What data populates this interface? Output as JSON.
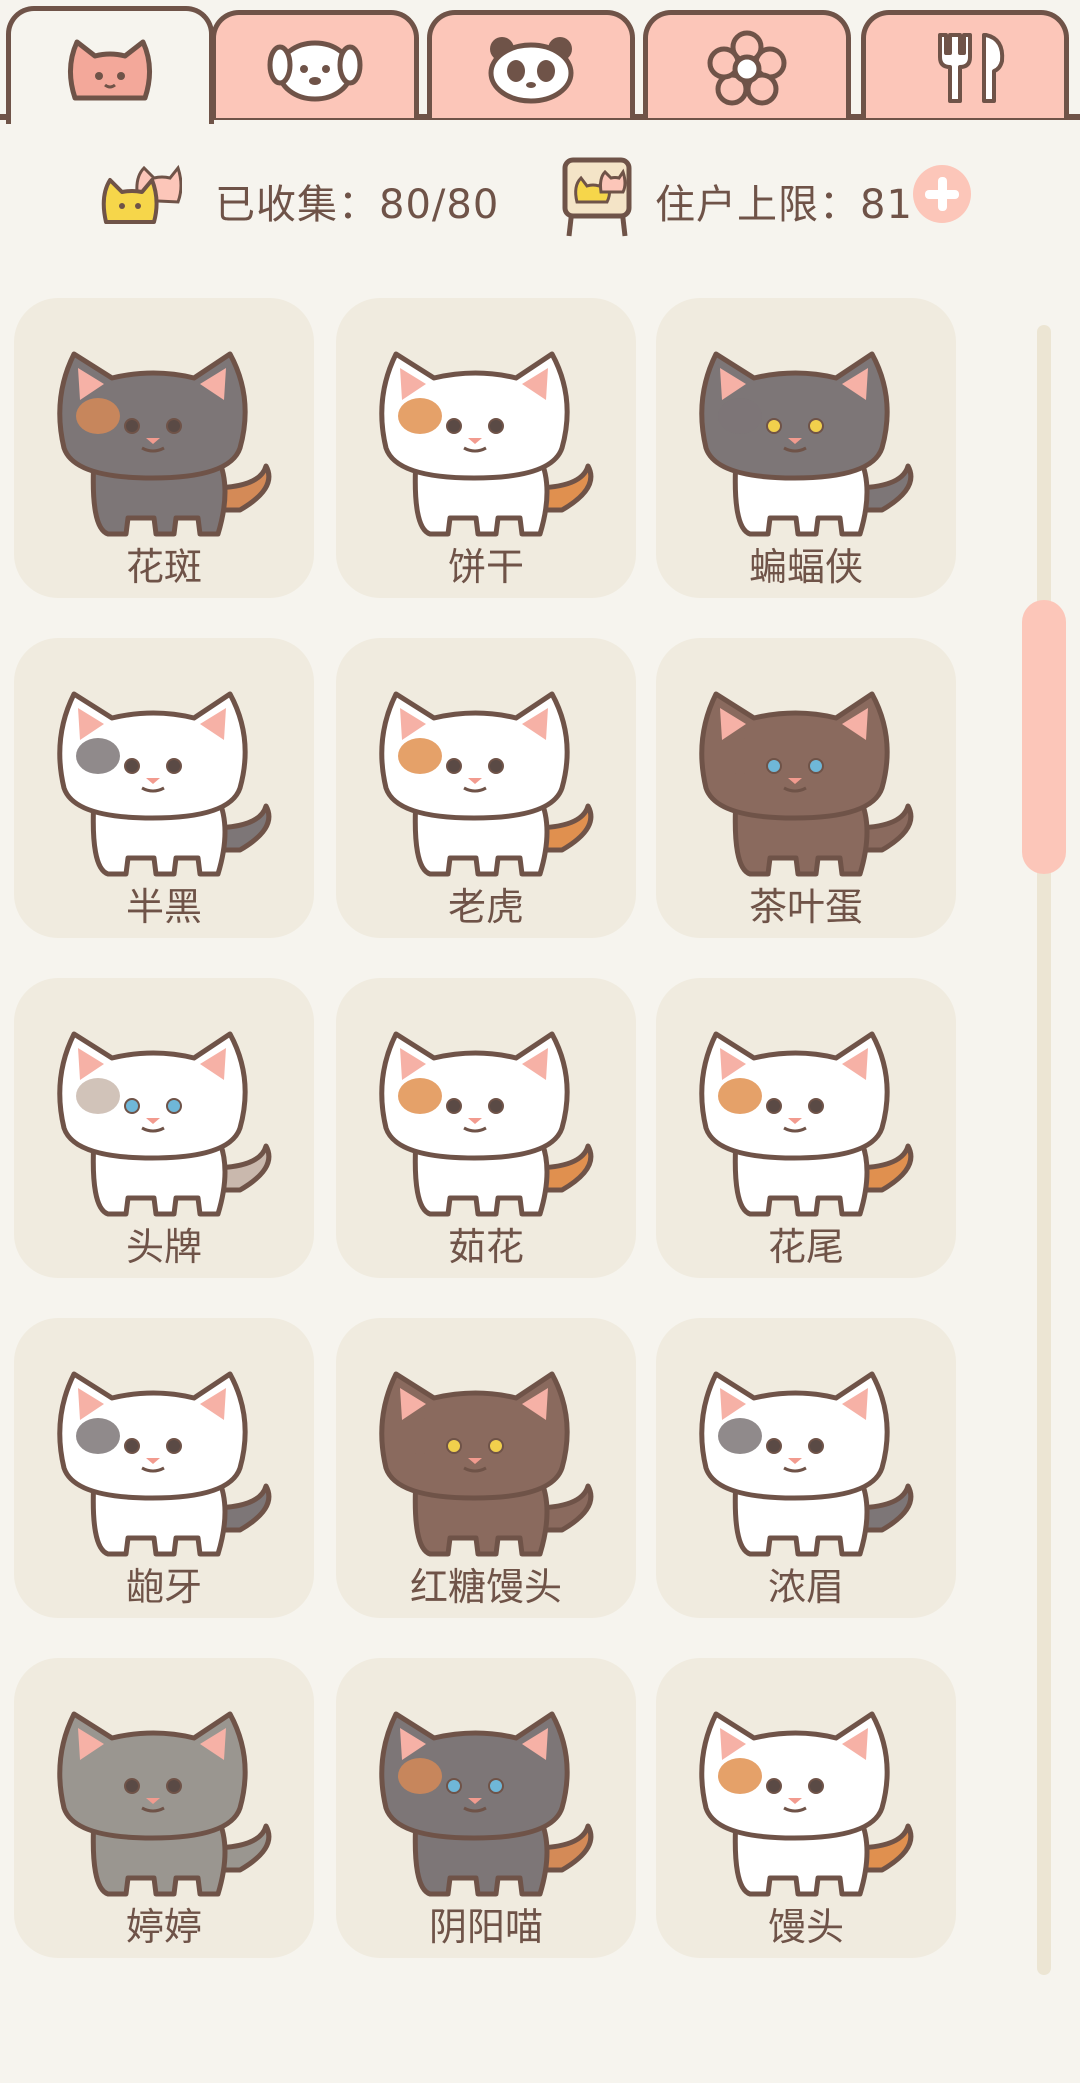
{
  "tabs": [
    {
      "id": "cats",
      "icon": "cat-face-icon",
      "active": true
    },
    {
      "id": "dogs",
      "icon": "dog-face-icon",
      "active": false
    },
    {
      "id": "pandas",
      "icon": "panda-face-icon",
      "active": false
    },
    {
      "id": "flowers",
      "icon": "flower-icon",
      "active": false
    },
    {
      "id": "food",
      "icon": "fork-spoon-icon",
      "active": false
    }
  ],
  "stats": {
    "collected_label": "已收集：80/80",
    "residents_label": "住户上限：81"
  },
  "colors": {
    "tab_bg": "#fcc6b9",
    "outline": "#6f5348",
    "page_bg": "#f6f4ee",
    "card_bg": "#f0ebdf",
    "scroll_thumb": "#fcc6b9"
  },
  "cats": [
    {
      "name": "花斑",
      "body": "#7d7677",
      "patch": "#d48a57",
      "head": "#7d7677",
      "eye": "#5a4a45"
    },
    {
      "name": "饼干",
      "body": "#ffffff",
      "patch": "#e0904f",
      "head": "#ffffff",
      "eye": "#5a4a45"
    },
    {
      "name": "蝙蝠侠",
      "body": "#ffffff",
      "patch": "#7d7677",
      "head": "#7d7677",
      "eye": "#f1d04c"
    },
    {
      "name": "半黑",
      "body": "#ffffff",
      "patch": "#7d7677",
      "head": "#ffffff",
      "eye": "#5a4a45"
    },
    {
      "name": "老虎",
      "body": "#ffffff",
      "patch": "#e0904f",
      "head": "#ffffff",
      "eye": "#5a4a45"
    },
    {
      "name": "茶叶蛋",
      "body": "#8a6a5e",
      "patch": "#8a6a5e",
      "head": "#8a6a5e",
      "eye": "#6fb7d8"
    },
    {
      "name": "头牌",
      "body": "#ffffff",
      "patch": "#c9b8ad",
      "head": "#ffffff",
      "eye": "#6fb7d8"
    },
    {
      "name": "茹花",
      "body": "#ffffff",
      "patch": "#e0904f",
      "head": "#ffffff",
      "eye": "#5a4a45"
    },
    {
      "name": "花尾",
      "body": "#ffffff",
      "patch": "#e0904f",
      "head": "#ffffff",
      "eye": "#5a4a45"
    },
    {
      "name": "龅牙",
      "body": "#ffffff",
      "patch": "#7d7677",
      "head": "#ffffff",
      "eye": "#5a4a45"
    },
    {
      "name": "红糖馒头",
      "body": "#8a6a5e",
      "patch": "#8a6a5e",
      "head": "#8a6a5e",
      "eye": "#f1d04c"
    },
    {
      "name": "浓眉",
      "body": "#ffffff",
      "patch": "#7d7677",
      "head": "#ffffff",
      "eye": "#5a4a45"
    },
    {
      "name": "婷婷",
      "body": "#9a9690",
      "patch": "#9a9690",
      "head": "#9a9690",
      "eye": "#5a4a45"
    },
    {
      "name": "阴阳喵",
      "body": "#7d7677",
      "patch": "#d48a57",
      "head": "#7d7677",
      "eye": "#6fb7d8"
    },
    {
      "name": "馒头",
      "body": "#ffffff",
      "patch": "#e0904f",
      "head": "#ffffff",
      "eye": "#5a4a45"
    }
  ]
}
